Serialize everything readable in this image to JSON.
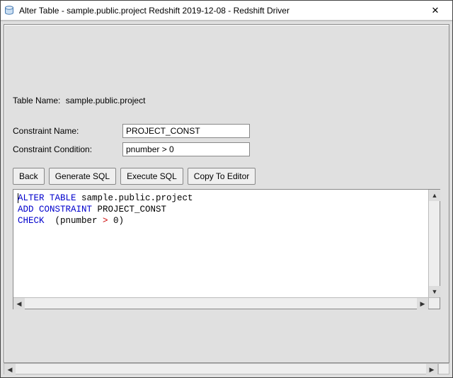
{
  "window": {
    "title": "Alter Table - sample.public.project Redshift 2019-12-08 - Redshift Driver",
    "close_glyph": "✕"
  },
  "form": {
    "table_name_label": "Table Name:",
    "table_name_value": "sample.public.project",
    "constraint_name_label": "Constraint Name:",
    "constraint_name_value": "PROJECT_CONST",
    "constraint_condition_label": "Constraint Condition:",
    "constraint_condition_value": "pnumber > 0"
  },
  "buttons": {
    "back": "Back",
    "generate_sql": "Generate SQL",
    "execute_sql": "Execute SQL",
    "copy_to_editor": "Copy To Editor"
  },
  "sql": {
    "kw_alter_table": "ALTER TABLE",
    "obj": "sample.public.project",
    "kw_add_constraint": "ADD CONSTRAINT",
    "const_name": "PROJECT_CONST",
    "kw_check": "CHECK",
    "check_open": "  (pnumber ",
    "op_gt": ">",
    "check_close": " 0)"
  },
  "scroll": {
    "up": "▲",
    "down": "▼",
    "left": "◀",
    "right": "▶"
  }
}
